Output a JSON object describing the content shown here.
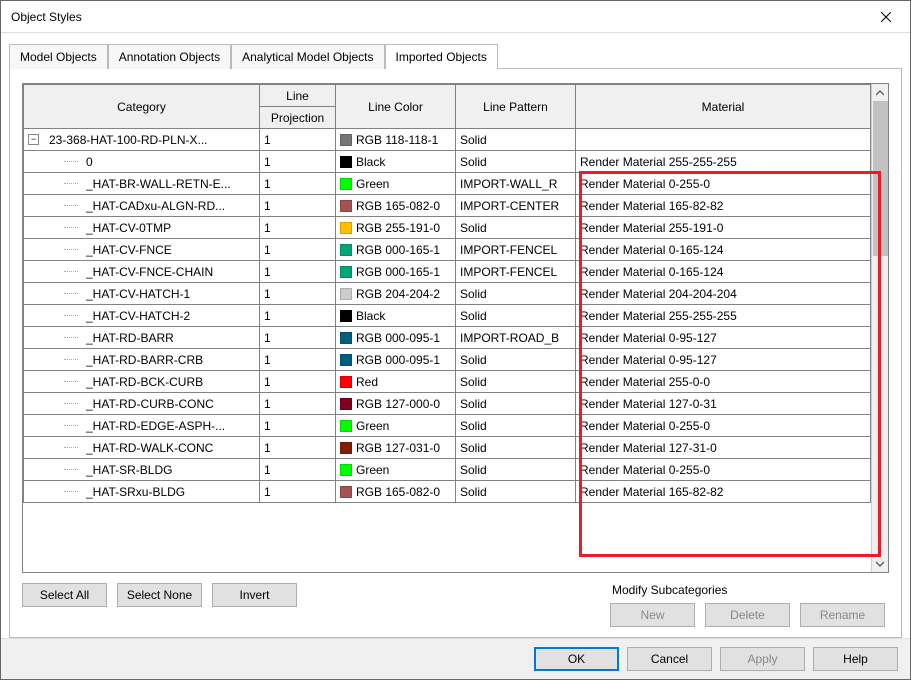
{
  "window": {
    "title": "Object Styles"
  },
  "tabs": {
    "items": [
      {
        "label": "Model Objects"
      },
      {
        "label": "Annotation Objects"
      },
      {
        "label": "Analytical Model Objects"
      },
      {
        "label": "Imported Objects"
      }
    ],
    "active_index": 3
  },
  "headers": {
    "category": "Category",
    "line": "Line",
    "projection": "Projection",
    "line_color": "Line Color",
    "line_pattern": "Line Pattern",
    "material": "Material"
  },
  "rows": [
    {
      "depth": 0,
      "expander": "minus",
      "category": "23-368-HAT-100-RD-PLN-X...",
      "projection": "1",
      "color_hex": "#767676",
      "color_label": "RGB 118-118-1",
      "pattern": "Solid",
      "material": ""
    },
    {
      "depth": 1,
      "category": "0",
      "projection": "1",
      "color_hex": "#000000",
      "color_label": "Black",
      "pattern": "Solid",
      "material": "Render Material 255-255-255"
    },
    {
      "depth": 1,
      "category": "_HAT-BR-WALL-RETN-E...",
      "projection": "1",
      "color_hex": "#00ff00",
      "color_label": "Green",
      "pattern": "IMPORT-WALL_R",
      "material": "Render Material 0-255-0"
    },
    {
      "depth": 1,
      "category": "_HAT-CADxu-ALGN-RD...",
      "projection": "1",
      "color_hex": "#a55252",
      "color_label": "RGB 165-082-0",
      "pattern": "IMPORT-CENTER",
      "material": "Render Material 165-82-82"
    },
    {
      "depth": 1,
      "category": "_HAT-CV-0TMP",
      "projection": "1",
      "color_hex": "#ffbf00",
      "color_label": "RGB 255-191-0",
      "pattern": "Solid",
      "material": "Render Material 255-191-0"
    },
    {
      "depth": 1,
      "category": "_HAT-CV-FNCE",
      "projection": "1",
      "color_hex": "#00a57c",
      "color_label": "RGB 000-165-1",
      "pattern": "IMPORT-FENCEL",
      "material": "Render Material 0-165-124"
    },
    {
      "depth": 1,
      "category": "_HAT-CV-FNCE-CHAIN",
      "projection": "1",
      "color_hex": "#00a57c",
      "color_label": "RGB 000-165-1",
      "pattern": "IMPORT-FENCEL",
      "material": "Render Material 0-165-124"
    },
    {
      "depth": 1,
      "category": "_HAT-CV-HATCH-1",
      "projection": "1",
      "color_hex": "#cccccc",
      "color_label": "RGB 204-204-2",
      "pattern": "Solid",
      "material": "Render Material 204-204-204"
    },
    {
      "depth": 1,
      "category": "_HAT-CV-HATCH-2",
      "projection": "1",
      "color_hex": "#000000",
      "color_label": "Black",
      "pattern": "Solid",
      "material": "Render Material 255-255-255"
    },
    {
      "depth": 1,
      "category": "_HAT-RD-BARR",
      "projection": "1",
      "color_hex": "#005f7f",
      "color_label": "RGB 000-095-1",
      "pattern": "IMPORT-ROAD_B",
      "material": "Render Material 0-95-127"
    },
    {
      "depth": 1,
      "category": "_HAT-RD-BARR-CRB",
      "projection": "1",
      "color_hex": "#005f7f",
      "color_label": "RGB 000-095-1",
      "pattern": "Solid",
      "material": "Render Material 0-95-127"
    },
    {
      "depth": 1,
      "category": "_HAT-RD-BCK-CURB",
      "projection": "1",
      "color_hex": "#ff0000",
      "color_label": "Red",
      "pattern": "Solid",
      "material": "Render Material 255-0-0"
    },
    {
      "depth": 1,
      "category": "_HAT-RD-CURB-CONC",
      "projection": "1",
      "color_hex": "#7f001f",
      "color_label": "RGB 127-000-0",
      "pattern": "Solid",
      "material": "Render Material 127-0-31"
    },
    {
      "depth": 1,
      "category": "_HAT-RD-EDGE-ASPH-...",
      "projection": "1",
      "color_hex": "#00ff00",
      "color_label": "Green",
      "pattern": "Solid",
      "material": "Render Material 0-255-0"
    },
    {
      "depth": 1,
      "category": "_HAT-RD-WALK-CONC",
      "projection": "1",
      "color_hex": "#7f1f00",
      "color_label": "RGB 127-031-0",
      "pattern": "Solid",
      "material": "Render Material 127-31-0"
    },
    {
      "depth": 1,
      "category": "_HAT-SR-BLDG",
      "projection": "1",
      "color_hex": "#00ff00",
      "color_label": "Green",
      "pattern": "Solid",
      "material": "Render Material 0-255-0"
    },
    {
      "depth": 1,
      "category": "_HAT-SRxu-BLDG",
      "projection": "1",
      "color_hex": "#a55252",
      "color_label": "RGB 165-082-0",
      "pattern": "Solid",
      "material": "Render Material 165-82-82"
    }
  ],
  "selection_buttons": {
    "select_all": "Select All",
    "select_none": "Select None",
    "invert": "Invert"
  },
  "modify_group": {
    "title": "Modify Subcategories",
    "new": "New",
    "delete": "Delete",
    "rename": "Rename"
  },
  "footer": {
    "ok": "OK",
    "cancel": "Cancel",
    "apply": "Apply",
    "help": "Help"
  }
}
